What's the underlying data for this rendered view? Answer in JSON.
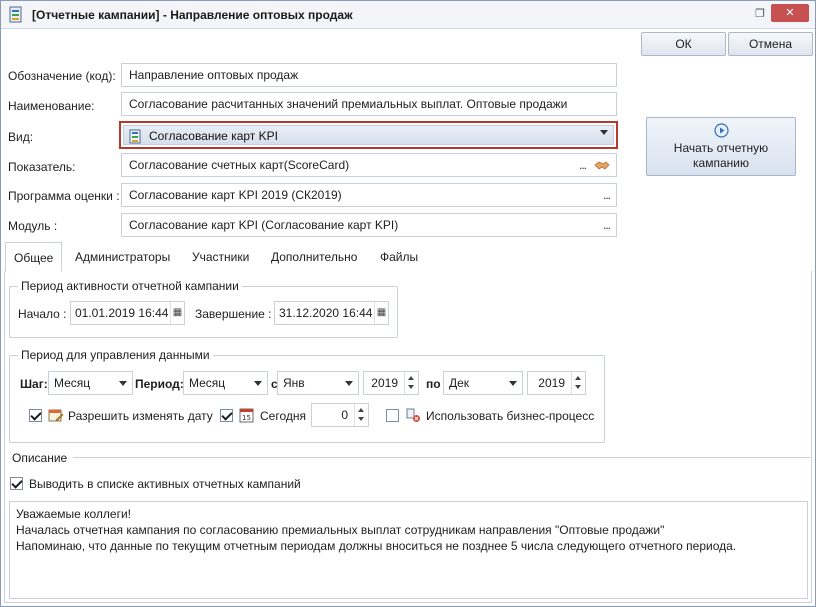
{
  "window": {
    "title": "[Отчетные кампании] - Направление оптовых продаж",
    "ok_label": "ОК",
    "cancel_label": "Отмена"
  },
  "form": {
    "code": {
      "label": "Обозначение (код):",
      "value": "Направление оптовых продаж"
    },
    "name": {
      "label": "Наименование:",
      "value": "Согласование расчитанных значений премиальных выплат. Оптовые продажи"
    },
    "kind": {
      "label": "Вид:",
      "value": "Согласование карт KPI"
    },
    "indicator": {
      "label": "Показатель:",
      "value": "Согласование счетных карт(ScoreCard)",
      "dots": "..."
    },
    "program": {
      "label": "Программа оценки :",
      "value": "Согласование карт KPI 2019 (СК2019)",
      "dots": "..."
    },
    "module": {
      "label": "Модуль :",
      "value": "Согласование карт KPI (Согласование карт KPI)",
      "dots": "..."
    },
    "start_button": {
      "line1": "Начать отчетную",
      "line2": "кампанию"
    }
  },
  "tabs": [
    {
      "label": "Общее",
      "active": true
    },
    {
      "label": "Администраторы",
      "active": false
    },
    {
      "label": "Участники",
      "active": false
    },
    {
      "label": "Дополнительно",
      "active": false
    },
    {
      "label": "Файлы",
      "active": false
    }
  ],
  "activity_period": {
    "title": "Период активности отчетной кампании",
    "start_label": "Начало :",
    "start_value": "01.01.2019 16:44",
    "end_label": "Завершение :",
    "end_value": "31.12.2020 16:44"
  },
  "data_period": {
    "title": "Период для управления данными",
    "step_label": "Шаг:",
    "step_value": "Месяц",
    "period_label": "Период:",
    "period_value": "Месяц",
    "from_label": "с",
    "from_month": "Янв",
    "from_year": "2019",
    "to_label": "по",
    "to_month": "Дек",
    "to_year": "2019",
    "allow_change_date": {
      "label": "Разрешить изменять дату",
      "checked": true
    },
    "today": {
      "label": "Сегодня",
      "checked": true,
      "value": "0"
    },
    "use_business_process": {
      "label": "Использовать бизнес-процесс",
      "checked": false
    }
  },
  "description": {
    "title": "Описание",
    "show_in_active": {
      "label": "Выводить в списке активных отчетных кампаний",
      "checked": true
    },
    "lines": [
      "Уважаемые коллеги!",
      "Началась отчетная кампания по согласованию премиальных выплат сотрудникам направления \"Оптовые продажи\"",
      "Напоминаю, что данные по текущим отчетным периодам должны вноситься не позднее 5 числа следующего отчетного периода."
    ]
  },
  "colors": {
    "highlight_border": "#b3392c",
    "window_border": "#8a9bb3",
    "close_button": "#c75050"
  }
}
